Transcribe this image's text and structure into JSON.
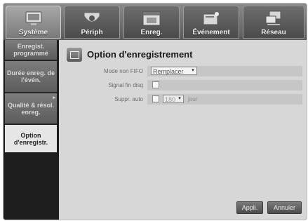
{
  "tabs": [
    {
      "label": "Système",
      "icon": "system-icon",
      "active": true
    },
    {
      "label": "Périph",
      "icon": "camera-icon",
      "active": false
    },
    {
      "label": "Enreg.",
      "icon": "record-icon",
      "active": false
    },
    {
      "label": "Événement",
      "icon": "event-icon",
      "active": false
    },
    {
      "label": "Réseau",
      "icon": "network-icon",
      "active": false
    }
  ],
  "sidebar": {
    "items": [
      {
        "label": "Enregist. programmé"
      },
      {
        "label": "Durée enreg. de l'évén."
      },
      {
        "label": "Qualité & résol. enreg."
      },
      {
        "label": "Option d'enregistr.",
        "active": true
      }
    ]
  },
  "panel": {
    "title": "Option d'enregistrement"
  },
  "form": {
    "mode_label": "Mode non FIFO",
    "mode_value": "Remplacer",
    "signal_label": "Signal fin disq",
    "suppr_label": "Suppr. auto",
    "suppr_value": "180",
    "suppr_unit": "jour"
  },
  "buttons": {
    "apply": "Appli.",
    "cancel": "Annuler"
  },
  "colors": {
    "panel_bg": "#d7d7d7",
    "sidebar_active": "#e6e6e6"
  }
}
